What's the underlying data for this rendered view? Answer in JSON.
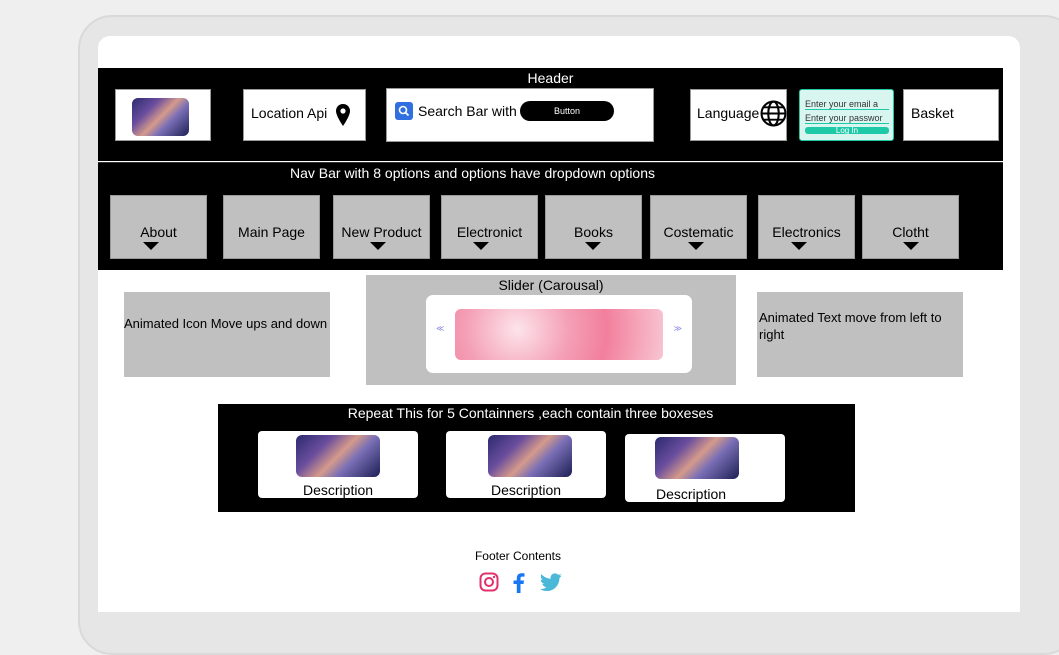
{
  "header": {
    "title": "Header",
    "location_label": "Location Api",
    "search_label": "Search Bar with I",
    "search_button": "Button",
    "language_label": "Language",
    "login": {
      "email_placeholder": "Enter your email a",
      "password_placeholder": "Enter your passwor",
      "button": "Log In"
    },
    "basket_label": "Basket"
  },
  "navbar": {
    "title": "Nav Bar with 8 options and options have dropdown options",
    "items": [
      {
        "label": "About",
        "dropdown": true
      },
      {
        "label": "Main Page",
        "dropdown": false
      },
      {
        "label": "New Product",
        "dropdown": true
      },
      {
        "label": "Electronict",
        "dropdown": true
      },
      {
        "label": "Books",
        "dropdown": true
      },
      {
        "label": "Costematic",
        "dropdown": true
      },
      {
        "label": "Electronics",
        "dropdown": true
      },
      {
        "label": "Clotht",
        "dropdown": true
      }
    ]
  },
  "hero": {
    "left_text": "Animated Icon Move ups and down",
    "slider_title": "Slider (Carousal)",
    "right_text": "Animated Text move from left to right"
  },
  "containers": {
    "title": "Repeat This for 5  Containners ,each contain three boxeses",
    "cards": [
      {
        "description": "Description"
      },
      {
        "description": "Description"
      },
      {
        "description": "Description"
      }
    ]
  },
  "footer": {
    "text": "Footer Contents",
    "icons": [
      "instagram-icon",
      "facebook-icon",
      "twitter-icon"
    ]
  },
  "colors": {
    "instagram": "#e1306c",
    "facebook": "#1877f2",
    "twitter": "#4ab8d6",
    "search_icon_bg": "#2f6fe0",
    "login_accent": "#1ec9a8"
  }
}
